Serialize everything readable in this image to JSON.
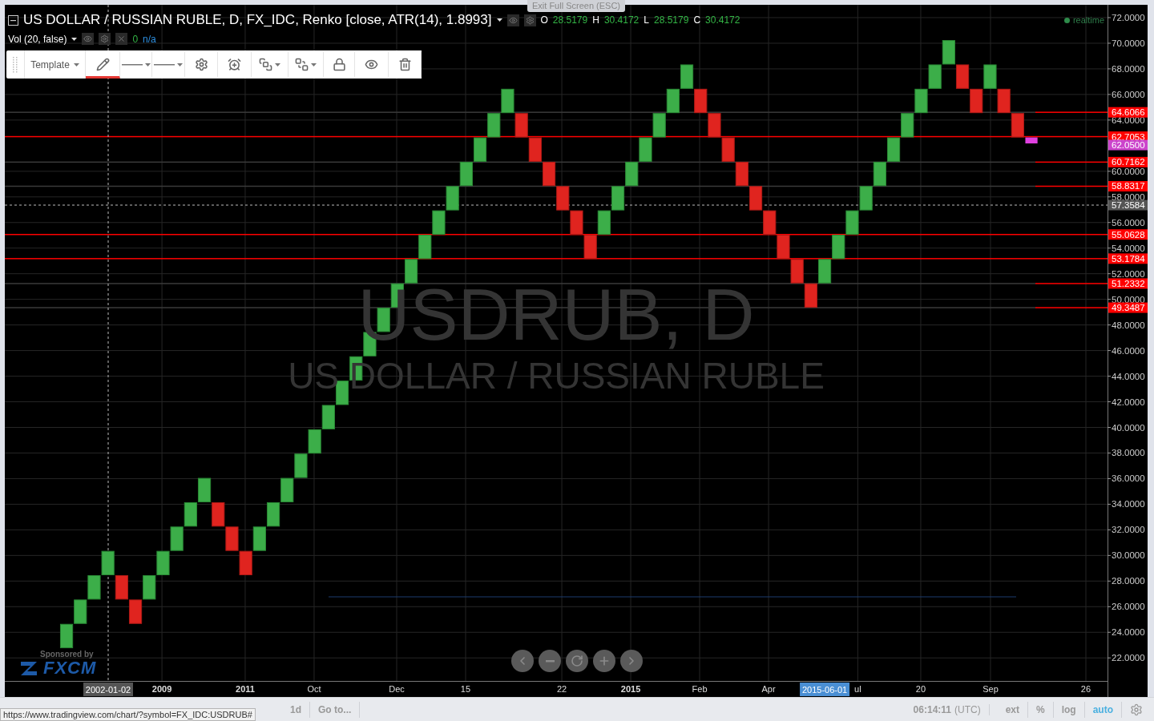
{
  "exit_fullscreen": "Exit Full Screen (ESC)",
  "legend": {
    "title": "US DOLLAR / RUSSIAN RUBLE, D, FX_IDC, Renko [close, ATR(14), 1.8993]",
    "ohlc": [
      {
        "label": "O",
        "value": "28.5179"
      },
      {
        "label": "H",
        "value": "30.4172"
      },
      {
        "label": "L",
        "value": "28.5179"
      },
      {
        "label": "C",
        "value": "30.4172"
      }
    ]
  },
  "indicator": {
    "title": "Vol (20, false)",
    "value": "0",
    "value2": "n/a"
  },
  "realtime": "realtime",
  "drawing_toolbar": {
    "template": "Template",
    "tools": [
      {
        "kind": "pencil",
        "selected": true
      },
      {
        "kind": "line-style",
        "selected": false
      },
      {
        "kind": "line-width",
        "selected": false
      },
      {
        "kind": "settings",
        "selected": false
      },
      {
        "kind": "alert",
        "selected": false
      },
      {
        "kind": "bring-front",
        "selected": false
      },
      {
        "kind": "send-back",
        "selected": false
      },
      {
        "kind": "lock",
        "selected": false
      },
      {
        "kind": "visibility",
        "selected": false
      },
      {
        "kind": "delete",
        "selected": false
      }
    ]
  },
  "watermark": {
    "symbol": "USDRUB, D",
    "description": "US DOLLAR / RUSSIAN RUBLE"
  },
  "sponsor": {
    "caption": "Sponsored by",
    "brand": "FXCM"
  },
  "bricks": [
    {
      "rising": true
    },
    {
      "rising": true
    },
    {
      "rising": true
    },
    {
      "rising": true
    },
    {
      "rising": false
    },
    {
      "rising": false
    },
    {
      "rising": true
    },
    {
      "rising": true
    },
    {
      "rising": true
    },
    {
      "rising": true
    },
    {
      "rising": true
    },
    {
      "rising": false
    },
    {
      "rising": false
    },
    {
      "rising": false
    },
    {
      "rising": true
    },
    {
      "rising": true
    },
    {
      "rising": true
    },
    {
      "rising": true
    },
    {
      "rising": true
    },
    {
      "rising": true
    },
    {
      "rising": true
    },
    {
      "rising": true
    },
    {
      "rising": true
    },
    {
      "rising": true
    },
    {
      "rising": true
    },
    {
      "rising": true
    },
    {
      "rising": true
    },
    {
      "rising": true
    },
    {
      "rising": true
    },
    {
      "rising": true
    },
    {
      "rising": true
    },
    {
      "rising": true
    },
    {
      "rising": true
    },
    {
      "rising": false
    },
    {
      "rising": false
    },
    {
      "rising": false
    },
    {
      "rising": false
    },
    {
      "rising": false
    },
    {
      "rising": false
    },
    {
      "rising": true
    },
    {
      "rising": true
    },
    {
      "rising": true
    },
    {
      "rising": true
    },
    {
      "rising": true
    },
    {
      "rising": true
    },
    {
      "rising": true
    },
    {
      "rising": false
    },
    {
      "rising": false
    },
    {
      "rising": false
    },
    {
      "rising": false
    },
    {
      "rising": false
    },
    {
      "rising": false
    },
    {
      "rising": false
    },
    {
      "rising": false
    },
    {
      "rising": false
    },
    {
      "rising": true
    },
    {
      "rising": true
    },
    {
      "rising": true
    },
    {
      "rising": true
    },
    {
      "rising": true
    },
    {
      "rising": true
    },
    {
      "rising": true
    },
    {
      "rising": true
    },
    {
      "rising": true
    },
    {
      "rising": true
    },
    {
      "rising": false
    },
    {
      "rising": false
    },
    {
      "rising": true
    },
    {
      "rising": false
    },
    {
      "rising": false
    }
  ],
  "price_axis": [
    "72.0000",
    "70.0000",
    "68.0000",
    "66.0000",
    "64.0000",
    "60.0000",
    "58.0000",
    "56.0000",
    "54.0000",
    "52.0000",
    "50.0000",
    "48.0000",
    "46.0000",
    "44.0000",
    "42.0000",
    "40.0000",
    "38.0000",
    "36.0000",
    "34.0000",
    "32.0000",
    "30.0000",
    "28.0000",
    "26.0000",
    "24.0000",
    "22.0000"
  ],
  "price_tags": [
    {
      "label": "64.6066",
      "kind": "level",
      "full_line": false
    },
    {
      "label": "62.7053",
      "kind": "level",
      "full_line": true
    },
    {
      "label": "62.0500",
      "kind": "current"
    },
    {
      "label": "60.7162",
      "kind": "level",
      "full_line": false
    },
    {
      "label": "58.8317",
      "kind": "level",
      "full_line": false
    },
    {
      "label": "57.3584",
      "kind": "crosshair"
    },
    {
      "label": "55.0628",
      "kind": "level",
      "full_line": true
    },
    {
      "label": "53.1784",
      "kind": "level",
      "full_line": true
    },
    {
      "label": "51.2332",
      "kind": "level",
      "full_line": false
    },
    {
      "label": "49.3487",
      "kind": "level",
      "full_line": false
    }
  ],
  "time_axis": {
    "labels": [
      {
        "label": "2009",
        "emphasis": true
      },
      {
        "label": "2011",
        "emphasis": true
      },
      {
        "label": "Oct",
        "emphasis": false
      },
      {
        "label": "Dec",
        "emphasis": false
      },
      {
        "label": "15",
        "emphasis": false
      },
      {
        "label": "22",
        "emphasis": false
      },
      {
        "label": "2015",
        "emphasis": true
      },
      {
        "label": "Feb",
        "emphasis": false
      },
      {
        "label": "Apr",
        "emphasis": false
      },
      {
        "label": "ul",
        "emphasis": false
      },
      {
        "label": "20",
        "emphasis": false
      },
      {
        "label": "Sep",
        "emphasis": false
      },
      {
        "label": "26",
        "emphasis": false
      }
    ],
    "crosshair_date": "2002-01-02",
    "marker_date": "2015-06-01"
  },
  "navigation": [
    {
      "kind": "back"
    },
    {
      "kind": "zoom-out"
    },
    {
      "kind": "reset"
    },
    {
      "kind": "zoom-in"
    },
    {
      "kind": "forward"
    }
  ],
  "bottom_bar": {
    "ranges": [
      "1d"
    ],
    "goto": "Go to...",
    "time": "06:14:11",
    "timezone": "(UTC)",
    "toggles": [
      {
        "label": "ext",
        "selected": false
      },
      {
        "label": "%",
        "selected": false
      },
      {
        "label": "log",
        "selected": false
      },
      {
        "label": "auto",
        "selected": true
      }
    ]
  },
  "status_url": "https://www.tradingview.com/chart/?symbol=FX_IDC:USDRUB#"
}
